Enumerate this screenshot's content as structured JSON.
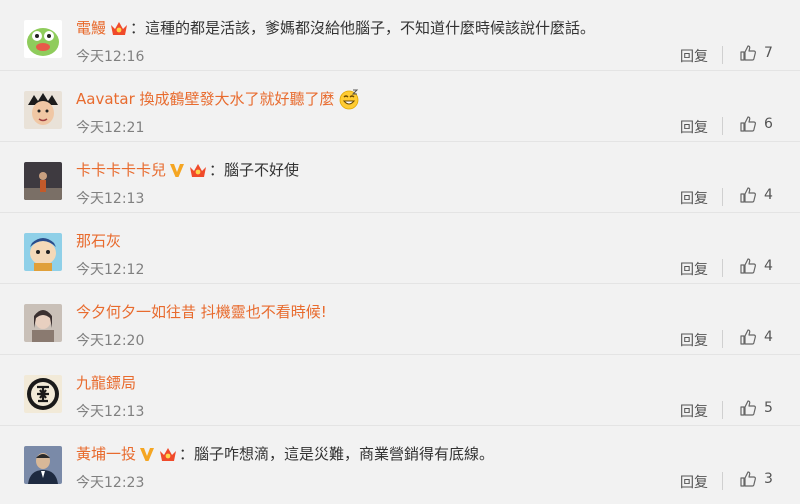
{
  "comments": [
    {
      "username": "電鰻",
      "vip": false,
      "crown": true,
      "emoji": false,
      "text": "這種的都是活該，爹媽都沒給他腦子，不知道什麼時候該說什麼話。",
      "time": "今天12:16",
      "reply": "回复",
      "likes": "7",
      "avatar_color": "#9bcf6a"
    },
    {
      "username": "Aavatar 換成鶴壁發大水了就好聽了麼",
      "vip": false,
      "crown": false,
      "emoji": true,
      "text": "",
      "time": "今天12:21",
      "reply": "回复",
      "likes": "6",
      "avatar_color": "#d8b79a"
    },
    {
      "username": "卡卡卡卡卡兒",
      "vip": true,
      "crown": true,
      "emoji": false,
      "text": "腦子不好使",
      "time": "今天12:13",
      "reply": "回复",
      "likes": "4",
      "avatar_color": "#6e6a72"
    },
    {
      "username": "那石灰",
      "vip": false,
      "crown": false,
      "emoji": false,
      "text": "",
      "time": "今天12:12",
      "reply": "回复",
      "likes": "4",
      "avatar_color": "#6bb5d6"
    },
    {
      "username": "今夕何夕一如往昔 抖機靈也不看時候!",
      "vip": false,
      "crown": false,
      "emoji": false,
      "text": "",
      "time": "今天12:20",
      "reply": "回复",
      "likes": "4",
      "avatar_color": "#b8a9a0"
    },
    {
      "username": "九龍鏢局",
      "vip": false,
      "crown": false,
      "emoji": false,
      "text": "",
      "time": "今天12:13",
      "reply": "回复",
      "likes": "5",
      "avatar_color": "#f0e6d0"
    },
    {
      "username": "黃埔一投",
      "vip": true,
      "crown": true,
      "emoji": false,
      "text": "腦子咋想滴，這是災難，商業營銷得有底線。",
      "time": "今天12:23",
      "reply": "回复",
      "likes": "3",
      "avatar_color": "#4a5a78"
    }
  ],
  "colors": {
    "username": "#e86b2e",
    "vip": "#f5a623",
    "crown": "#f04a2a"
  },
  "icons": {
    "like": "thumbs-up-icon",
    "vip": "vip-v-icon",
    "crown": "crown-badge-icon",
    "emoji": "grin-emoji-icon"
  },
  "colon": "："
}
